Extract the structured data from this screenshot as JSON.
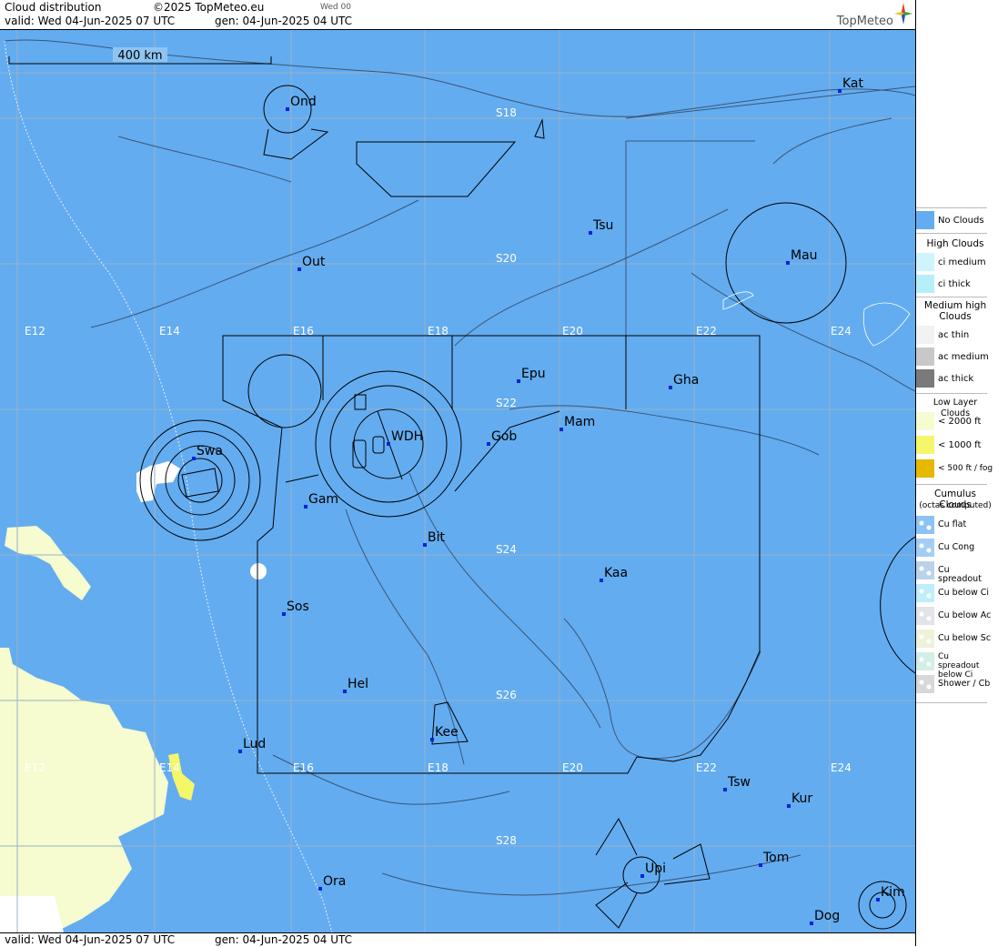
{
  "header": {
    "title": "Cloud distribution",
    "copyright": "©2025 TopMeteo.eu",
    "day_tag": "Wed 00",
    "valid": "valid:  Wed  04-Jun-2025  07 UTC",
    "generated": "gen: 04-Jun-2025 04 UTC",
    "brand": "TopMeteo"
  },
  "footer": {
    "valid": "valid:  Wed  04-Jun-2025  07 UTC",
    "generated": "gen: 04-Jun-2025 04 UTC"
  },
  "map": {
    "scale_label": "400 km",
    "colors": {
      "sea_land": "#63acf0",
      "grid": "#9ab2c8",
      "low_cloud": "#f6fbd0",
      "white": "#ffffff"
    },
    "lon_labels": [
      "E12",
      "E14",
      "E16",
      "E18",
      "E20",
      "E22",
      "E24"
    ],
    "lat_labels": [
      "S18",
      "S20",
      "S22",
      "S24",
      "S26",
      "S28"
    ],
    "stations": [
      "Ond",
      "Kat",
      "Tsu",
      "Mau",
      "Out",
      "Epu",
      "Gha",
      "Mam",
      "Swa",
      "WDH",
      "Gob",
      "Gam",
      "Bit",
      "Kaa",
      "Sos",
      "Hel",
      "Lud",
      "Kee",
      "Tsw",
      "Kur",
      "Tom",
      "Upi",
      "Ora",
      "Kim",
      "Dog"
    ]
  },
  "legend": {
    "no_clouds": "No Clouds",
    "high_header": "High Clouds",
    "high": [
      "ci medium",
      "ci thick"
    ],
    "medium_header": "Medium high Clouds",
    "medium": [
      "ac thin",
      "ac medium",
      "ac thick"
    ],
    "low_header": "Low Layer Clouds",
    "low": [
      "< 2000 ft",
      "< 1000 ft",
      "< 500 ft / fog"
    ],
    "cu_header": "Cumulus Clouds",
    "cu_sub": "(octas computed)",
    "cu": [
      "Cu flat",
      "Cu Cong",
      "Cu spreadout",
      "Cu below Ci",
      "Cu below Ac",
      "Cu below Sc",
      "Cu spreadout below Ci",
      "Shower / Cb"
    ],
    "colors": {
      "no": "#63acf0",
      "ci_medium": "#cff4ff",
      "ci_thick": "#b5f0fa",
      "ac_thin": "#f2f2f2",
      "ac_medium": "#c8c8c8",
      "ac_thick": "#7a7a7a",
      "low2000": "#f6fbd0",
      "low1000": "#f4f76a",
      "low500": "#e6b800"
    }
  }
}
